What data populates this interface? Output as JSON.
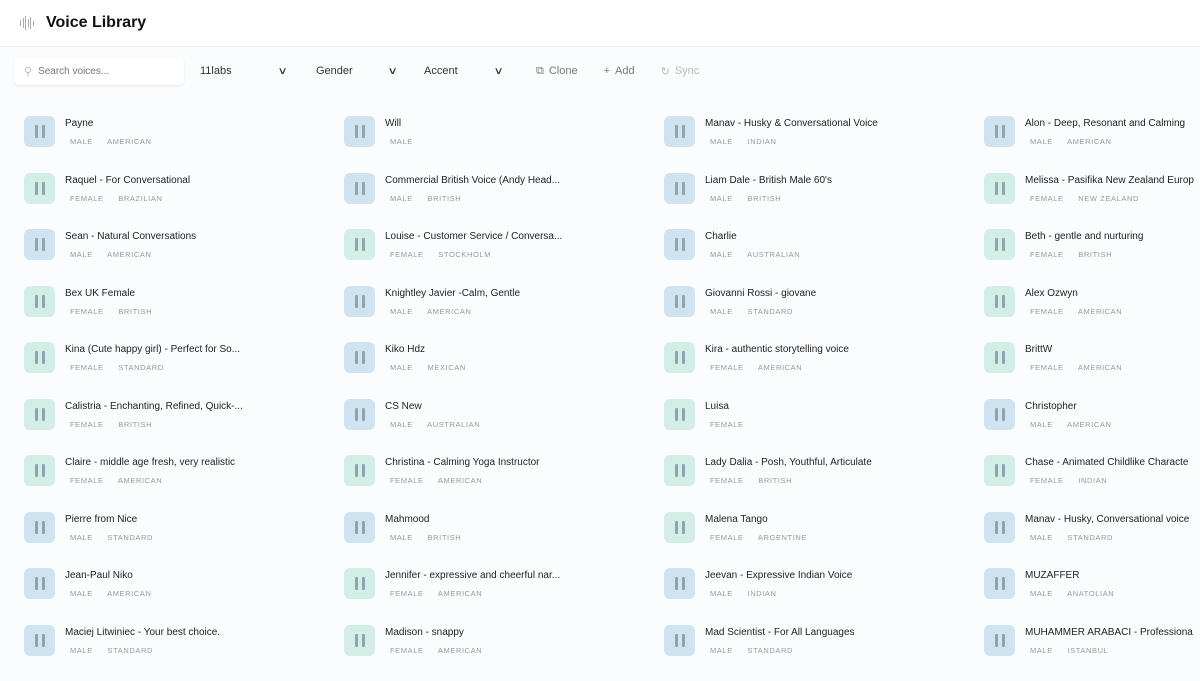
{
  "header": {
    "title": "Voice Library",
    "icon": "waveform-icon"
  },
  "toolbar": {
    "search_placeholder": "Search voices...",
    "provider": "11labs",
    "gender": "Gender",
    "accent": "Accent",
    "clone": "Clone",
    "add": "Add",
    "sync": "Sync"
  },
  "colors": {
    "male": "#cfe3f1",
    "female": "#d2eee5"
  },
  "voices": [
    {
      "name": "Payne",
      "gender": "MALE",
      "accent": "AMERICAN"
    },
    {
      "name": "Will",
      "gender": "MALE",
      "accent": ""
    },
    {
      "name": "Manav - Husky & Conversational Voice",
      "gender": "MALE",
      "accent": "INDIAN"
    },
    {
      "name": "Alon - Deep, Resonant and Calming",
      "gender": "MALE",
      "accent": "AMERICAN"
    },
    {
      "name": "Raquel - For Conversational",
      "gender": "FEMALE",
      "accent": "BRAZILIAN"
    },
    {
      "name": "Commercial British Voice (Andy Head...",
      "gender": "MALE",
      "accent": "BRITISH"
    },
    {
      "name": "Liam Dale - British Male 60's",
      "gender": "MALE",
      "accent": "BRITISH"
    },
    {
      "name": "Melissa - Pasifika New Zealand Europ",
      "gender": "FEMALE",
      "accent": "NEW ZEALAND"
    },
    {
      "name": "Sean - Natural Conversations",
      "gender": "MALE",
      "accent": "AMERICAN"
    },
    {
      "name": "Louise - Customer Service / Conversa...",
      "gender": "FEMALE",
      "accent": "STOCKHOLM"
    },
    {
      "name": "Charlie",
      "gender": "MALE",
      "accent": "AUSTRALIAN"
    },
    {
      "name": "Beth - gentle and nurturing",
      "gender": "FEMALE",
      "accent": "BRITISH"
    },
    {
      "name": "Bex UK Female",
      "gender": "FEMALE",
      "accent": "BRITISH"
    },
    {
      "name": "Knightley Javier -Calm, Gentle",
      "gender": "MALE",
      "accent": "AMERICAN"
    },
    {
      "name": "Giovanni Rossi - giovane",
      "gender": "MALE",
      "accent": "STANDARD"
    },
    {
      "name": "Alex Ozwyn",
      "gender": "FEMALE",
      "accent": "AMERICAN"
    },
    {
      "name": "Kina (Cute happy girl) - Perfect for So...",
      "gender": "FEMALE",
      "accent": "STANDARD"
    },
    {
      "name": "Kiko Hdz",
      "gender": "MALE",
      "accent": "MEXICAN"
    },
    {
      "name": "Kira - authentic storytelling voice",
      "gender": "FEMALE",
      "accent": "AMERICAN"
    },
    {
      "name": "BrittW",
      "gender": "FEMALE",
      "accent": "AMERICAN"
    },
    {
      "name": "Calistria - Enchanting, Refined, Quick-...",
      "gender": "FEMALE",
      "accent": "BRITISH"
    },
    {
      "name": "CS New",
      "gender": "MALE",
      "accent": "AUSTRALIAN"
    },
    {
      "name": "Luisa",
      "gender": "FEMALE",
      "accent": ""
    },
    {
      "name": "Christopher",
      "gender": "MALE",
      "accent": "AMERICAN"
    },
    {
      "name": "Claire - middle age fresh, very realistic",
      "gender": "FEMALE",
      "accent": "AMERICAN"
    },
    {
      "name": "Christina - Calming Yoga Instructor",
      "gender": "FEMALE",
      "accent": "AMERICAN"
    },
    {
      "name": "Lady Dalia - Posh, Youthful, Articulate",
      "gender": "FEMALE",
      "accent": "BRITISH"
    },
    {
      "name": "Chase - Animated Childlike Characte",
      "gender": "FEMALE",
      "accent": "INDIAN"
    },
    {
      "name": "Pierre from Nice",
      "gender": "MALE",
      "accent": "STANDARD"
    },
    {
      "name": "Mahmood",
      "gender": "MALE",
      "accent": "BRITISH"
    },
    {
      "name": "Malena Tango",
      "gender": "FEMALE",
      "accent": "ARGENTINE"
    },
    {
      "name": "Manav - Husky, Conversational voice",
      "gender": "MALE",
      "accent": "STANDARD"
    },
    {
      "name": "Jean-Paul Niko",
      "gender": "MALE",
      "accent": "AMERICAN"
    },
    {
      "name": "Jennifer - expressive and cheerful nar...",
      "gender": "FEMALE",
      "accent": "AMERICAN"
    },
    {
      "name": "Jeevan - Expressive Indian Voice",
      "gender": "MALE",
      "accent": "INDIAN"
    },
    {
      "name": "MUZAFFER",
      "gender": "MALE",
      "accent": "ANATOLIAN"
    },
    {
      "name": "Maciej Litwiniec - Your best choice.",
      "gender": "MALE",
      "accent": "STANDARD"
    },
    {
      "name": "Madison - snappy",
      "gender": "FEMALE",
      "accent": "AMERICAN"
    },
    {
      "name": "Mad Scientist - For All Languages",
      "gender": "MALE",
      "accent": "STANDARD"
    },
    {
      "name": "MUHAMMER ARABACI - Professiona",
      "gender": "MALE",
      "accent": "ISTANBUL"
    }
  ]
}
